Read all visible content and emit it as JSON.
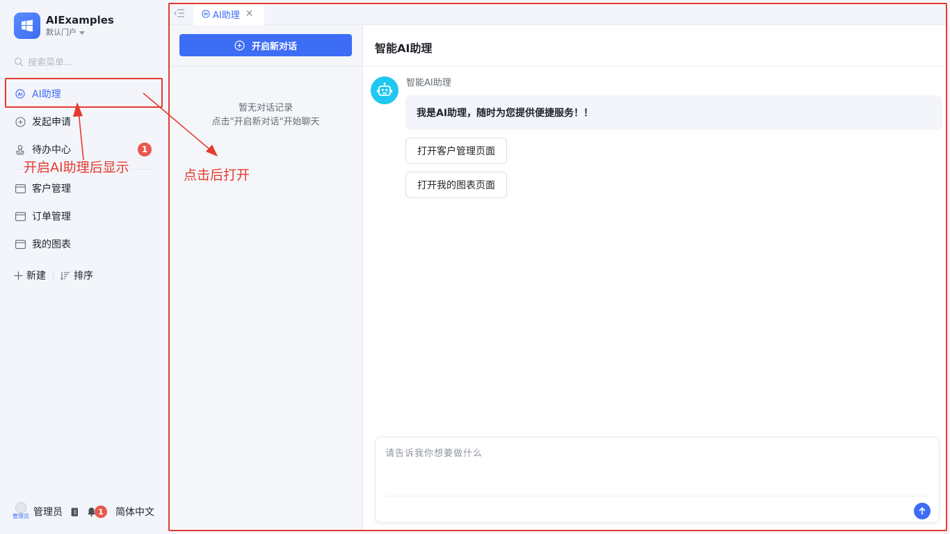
{
  "brand": {
    "name": "AIExamples",
    "portal": "默认门户"
  },
  "search": {
    "placeholder": "搜索菜单..."
  },
  "sidebar": {
    "items": [
      {
        "label": "AI助理",
        "icon": "ai-icon",
        "active": true
      },
      {
        "label": "发起申请",
        "icon": "plus-circle-icon"
      },
      {
        "label": "待办中心",
        "icon": "stamp-icon",
        "badge": "1"
      },
      {
        "label": "客户管理",
        "icon": "folder-icon"
      },
      {
        "label": "订单管理",
        "icon": "folder-icon"
      },
      {
        "label": "我的图表",
        "icon": "folder-icon"
      }
    ],
    "new_label": "新建",
    "sort_label": "排序"
  },
  "user_bar": {
    "name": "管理员",
    "avatar_tag": "管理员",
    "bell_badge": "1",
    "language": "简体中文"
  },
  "tabs": [
    {
      "label": "AI助理",
      "active": true
    }
  ],
  "conversations": {
    "new_chat_label": "开启新对话",
    "empty_line1": "暂无对话记录",
    "empty_line2": "点击\"开启新对话\"开始聊天"
  },
  "chat": {
    "title": "智能AI助理",
    "bot_name": "智能AI助理",
    "greeting": "我是AI助理，随时为您提供便捷服务！！",
    "quick_actions": [
      "打开客户管理页面",
      "打开我的图表页面"
    ],
    "input_placeholder": "请告诉我你想要做什么"
  },
  "annotations": {
    "menu_note": "开启AI助理后显示",
    "open_note": "点击后打开"
  },
  "colors": {
    "accent": "#3d6cf5",
    "badge": "#e9584e",
    "annotation": "#e53a2f",
    "bot": "#1ec8f0"
  }
}
